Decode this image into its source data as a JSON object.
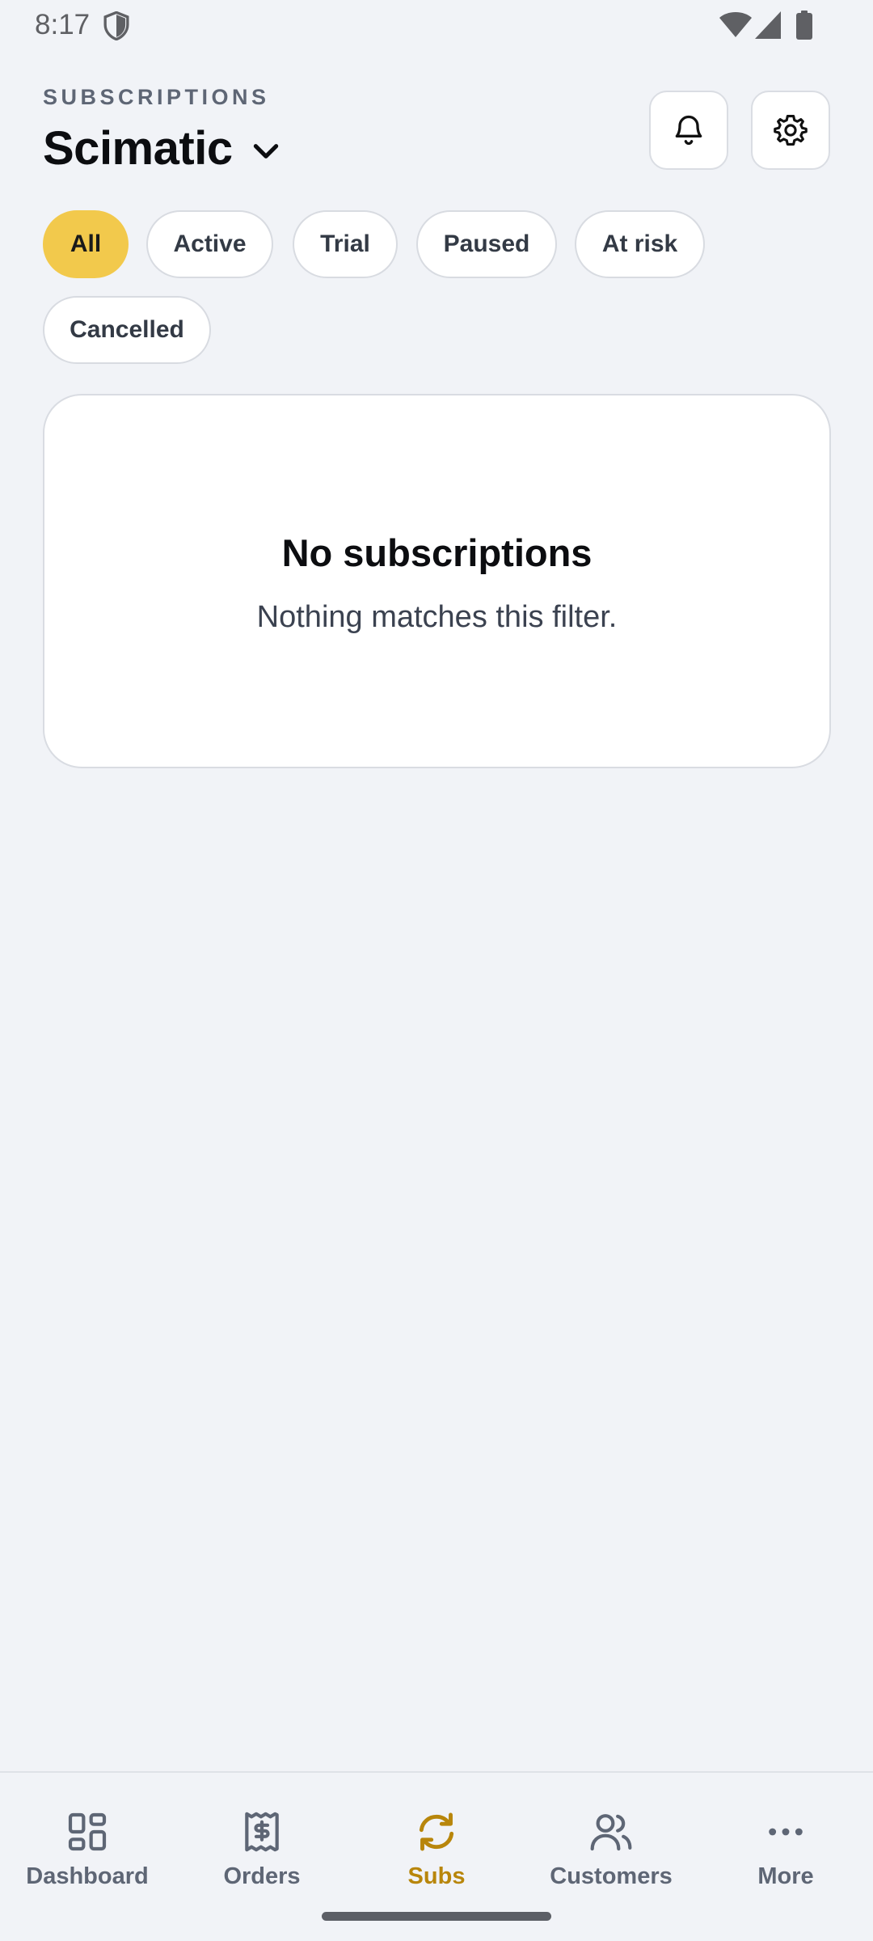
{
  "status_bar": {
    "time": "8:17"
  },
  "header": {
    "section_label": "SUBSCRIPTIONS",
    "workspace_name": "Scimatic",
    "notifications_icon": "bell-icon",
    "settings_icon": "gear-icon"
  },
  "filters": {
    "selected": "All",
    "chips": [
      "All",
      "Active",
      "Trial",
      "Paused",
      "At risk",
      "Cancelled"
    ]
  },
  "empty_state": {
    "title": "No subscriptions",
    "message": "Nothing matches this filter."
  },
  "bottom_nav": {
    "active": "Subs",
    "items": [
      {
        "label": "Dashboard",
        "icon": "dashboard-icon"
      },
      {
        "label": "Orders",
        "icon": "receipt-icon"
      },
      {
        "label": "Subs",
        "icon": "refresh-icon"
      },
      {
        "label": "Customers",
        "icon": "users-icon"
      },
      {
        "label": "More",
        "icon": "more-icon"
      }
    ]
  },
  "colors": {
    "accent": "#f2c94c",
    "active_nav": "#b8860b",
    "background": "#f1f3f7",
    "muted_text": "#5e6675"
  }
}
